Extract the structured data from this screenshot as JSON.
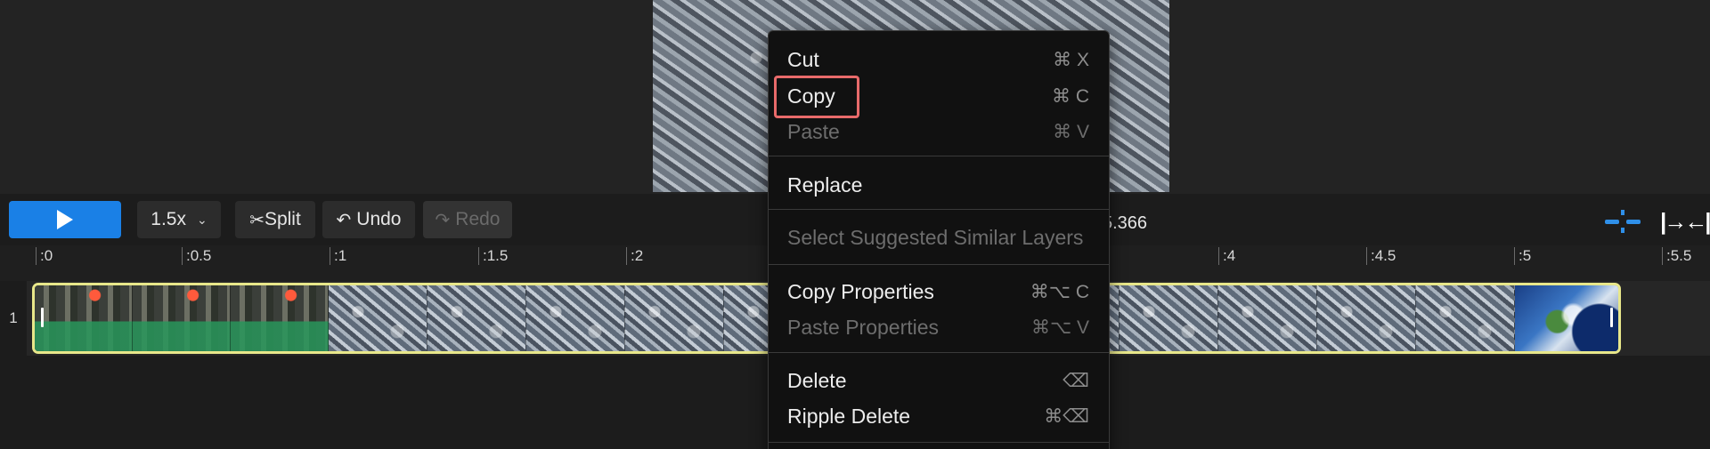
{
  "toolbar": {
    "speed_label": "1.5x",
    "split_label": "Split",
    "undo_label": "Undo",
    "redo_label": "Redo",
    "time_readout": "5.366"
  },
  "ruler": {
    "ticks": [
      ":0",
      ":0.5",
      ":1",
      ":1.5",
      ":2",
      ":4",
      ":4.5",
      ":5",
      ":5.5"
    ]
  },
  "track": {
    "number": "1"
  },
  "context_menu": {
    "items": [
      {
        "label": "Cut",
        "shortcut": "⌘ X",
        "enabled": true
      },
      {
        "label": "Copy",
        "shortcut": "⌘ C",
        "enabled": true,
        "highlighted": true
      },
      {
        "label": "Paste",
        "shortcut": "⌘ V",
        "enabled": false
      },
      {
        "label": "Replace",
        "shortcut": "",
        "enabled": true
      },
      {
        "label": "Select Suggested Similar Layers",
        "shortcut": "",
        "enabled": false
      },
      {
        "label": "Copy Properties",
        "shortcut": "⌘⌥ C",
        "enabled": true
      },
      {
        "label": "Paste Properties",
        "shortcut": "⌘⌥ V",
        "enabled": false
      },
      {
        "label": "Delete",
        "shortcut": "⌫",
        "enabled": true
      },
      {
        "label": "Ripple Delete",
        "shortcut": "⌘⌫",
        "enabled": true
      }
    ]
  },
  "colors": {
    "accent_blue": "#1a80e6",
    "clip_border": "#e8e78a",
    "highlight_red": "#e86a6a"
  }
}
